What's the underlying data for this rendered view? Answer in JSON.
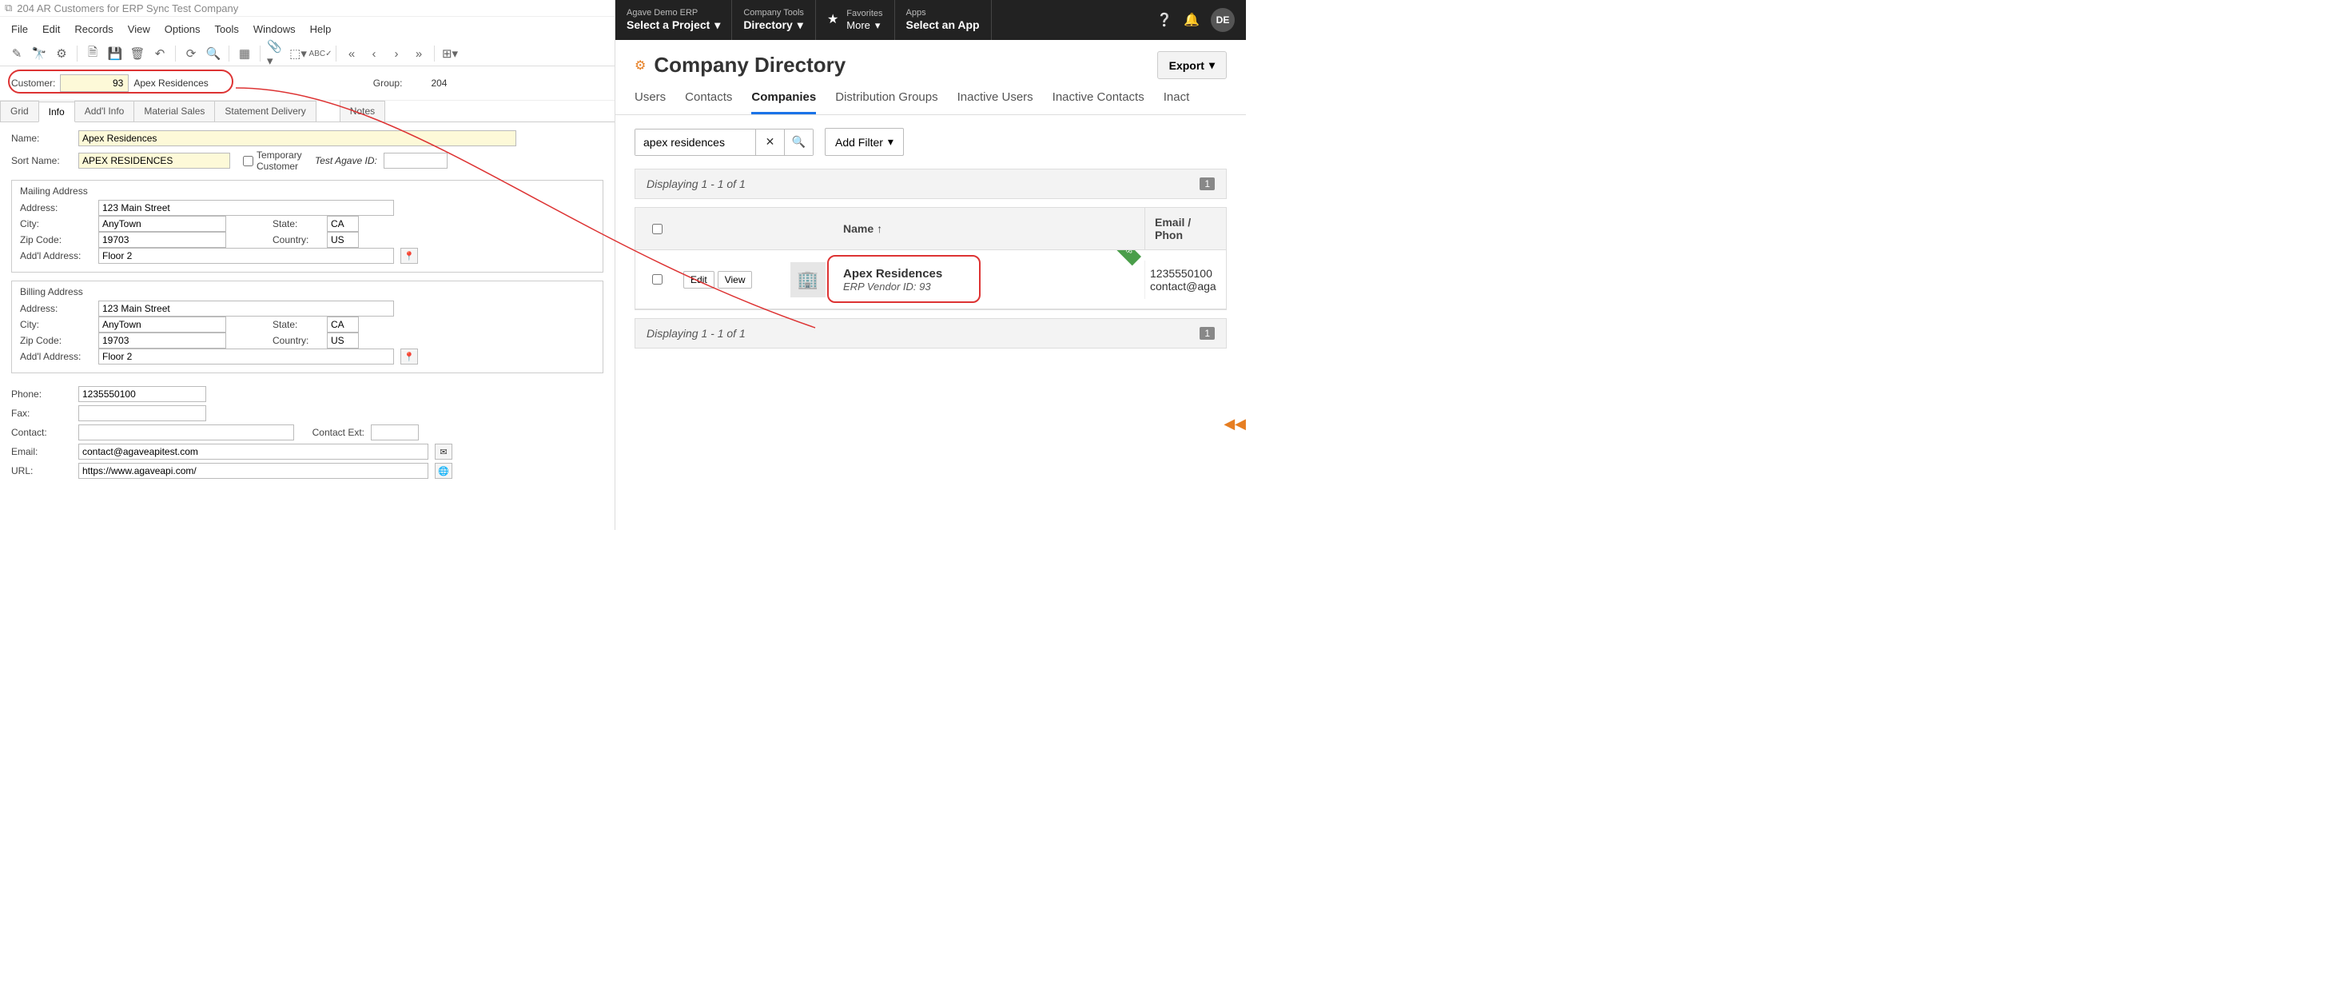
{
  "erp": {
    "window_title": "204 AR Customers for ERP Sync Test Company",
    "menu": [
      "File",
      "Edit",
      "Records",
      "View",
      "Options",
      "Tools",
      "Windows",
      "Help"
    ],
    "customer_label": "Customer:",
    "customer_id": "93",
    "customer_name": "Apex Residences",
    "group_label": "Group:",
    "group_val": "204",
    "tabs": [
      "Grid",
      "Info",
      "Add'l Info",
      "Material Sales",
      "Statement Delivery",
      "Notes"
    ],
    "active_tab_idx": 1,
    "name_label": "Name:",
    "name_val": "Apex Residences",
    "sortname_label": "Sort Name:",
    "sortname_val": "APEX RESIDENCES",
    "temp_cust_label": "Temporary Customer",
    "test_id_label": "Test Agave ID:",
    "mailing_title": "Mailing Address",
    "billing_title": "Billing Address",
    "addr": {
      "address_label": "Address:",
      "address_val": "123 Main Street",
      "city_label": "City:",
      "city_val": "AnyTown",
      "state_label": "State:",
      "state_val": "CA",
      "zip_label": "Zip Code:",
      "zip_val": "19703",
      "country_label": "Country:",
      "country_val": "US",
      "addl_label": "Add'l Address:",
      "addl_val": "Floor 2"
    },
    "phone_label": "Phone:",
    "phone_val": "1235550100",
    "fax_label": "Fax:",
    "contact_label": "Contact:",
    "contact_ext_label": "Contact Ext:",
    "email_label": "Email:",
    "email_val": "contact@agaveapitest.com",
    "url_label": "URL:",
    "url_val": "https://www.agaveapi.com/"
  },
  "web": {
    "nav": {
      "proj_small": "Agave Demo ERP",
      "proj_big": "Select a Project",
      "tools_small": "Company Tools",
      "tools_big": "Directory",
      "fav_small": "Favorites",
      "fav_big": "More",
      "apps_small": "Apps",
      "apps_big": "Select an App",
      "avatar": "DE"
    },
    "page_title": "Company Directory",
    "export_label": "Export",
    "tabs": [
      "Users",
      "Contacts",
      "Companies",
      "Distribution Groups",
      "Inactive Users",
      "Inactive Contacts",
      "Inact"
    ],
    "active_tab_idx": 2,
    "search_value": "apex residences",
    "add_filter_label": "Add Filter",
    "count_text": "Displaying 1 - 1 of 1",
    "page_badge": "1",
    "cols": {
      "name": "Name",
      "email": "Email / Phon"
    },
    "row": {
      "edit": "Edit",
      "view": "View",
      "name": "Apex Residences",
      "meta": "ERP Vendor ID: 93",
      "phone": "1235550100",
      "email": "contact@aga"
    }
  }
}
